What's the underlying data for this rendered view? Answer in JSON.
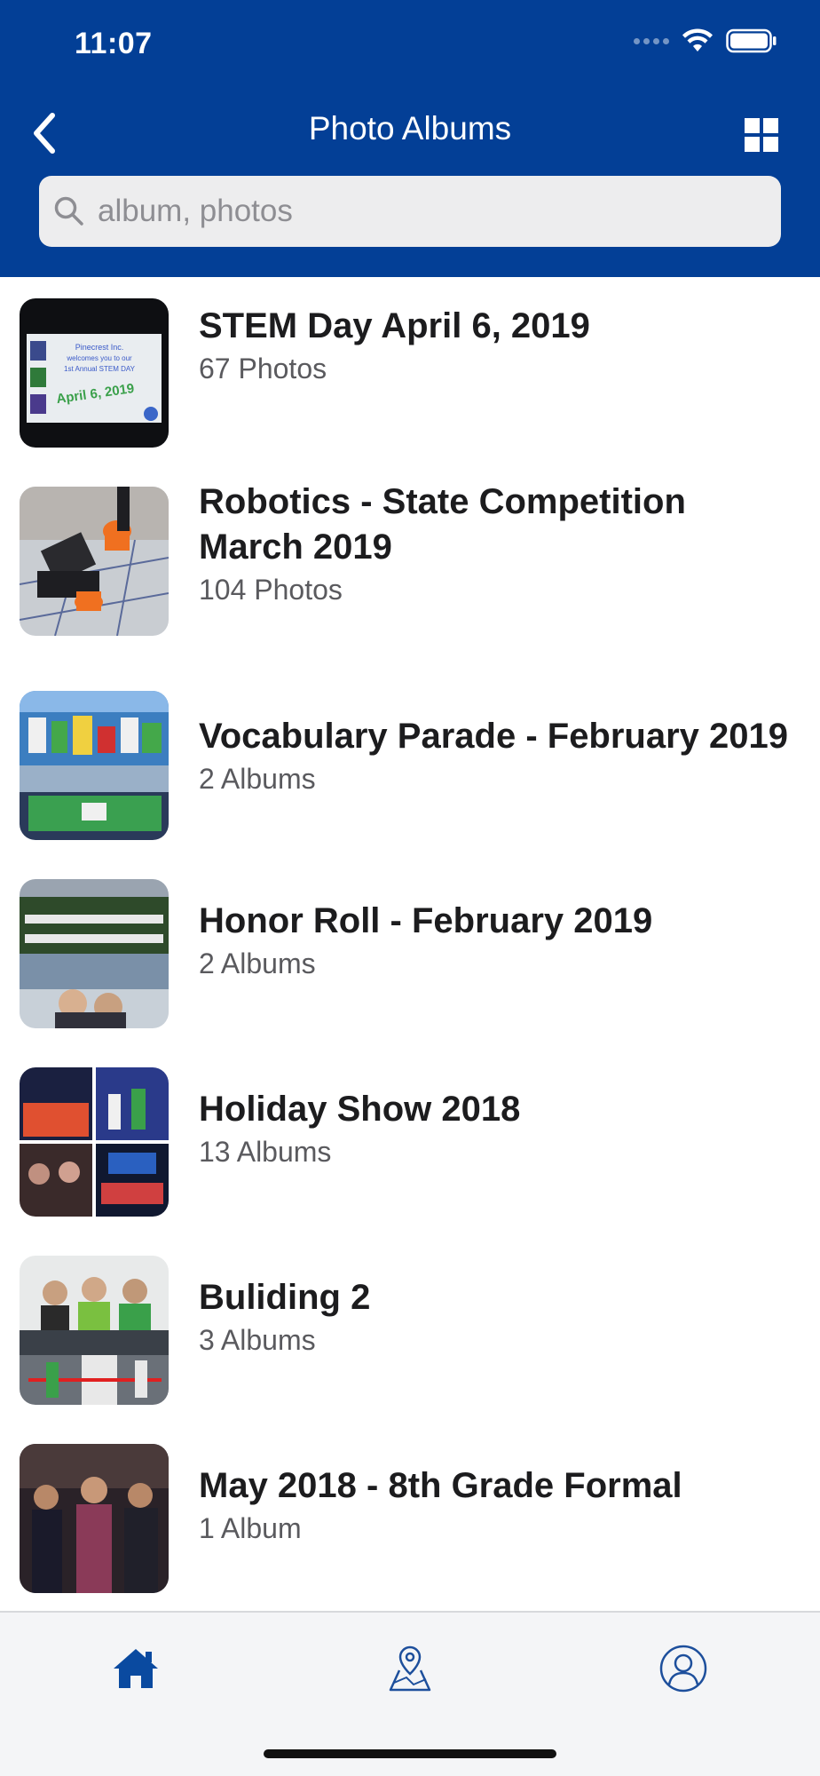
{
  "status_bar": {
    "time": "11:07"
  },
  "header": {
    "title": "Photo Albums"
  },
  "search": {
    "placeholder": "album, photos"
  },
  "albums": [
    {
      "title": "STEM Day April 6, 2019",
      "count": "67 Photos"
    },
    {
      "title": "Robotics - State Competition March 2019",
      "count": "104 Photos"
    },
    {
      "title": "Vocabulary Parade - February 2019",
      "count": "2 Albums"
    },
    {
      "title": "Honor Roll - February 2019",
      "count": "2 Albums"
    },
    {
      "title": "Holiday Show 2018",
      "count": "13 Albums"
    },
    {
      "title": "Buliding 2",
      "count": "3 Albums"
    },
    {
      "title": "May 2018 - 8th Grade Formal",
      "count": "1 Album"
    }
  ],
  "tabs": [
    {
      "icon": "home-icon",
      "active": true
    },
    {
      "icon": "map-pin-icon",
      "active": false
    },
    {
      "icon": "profile-icon",
      "active": false
    }
  ],
  "colors": {
    "header_bg": "#033f96",
    "tab_active": "#0a4aa0",
    "tab_inactive": "#1d4f9c"
  }
}
